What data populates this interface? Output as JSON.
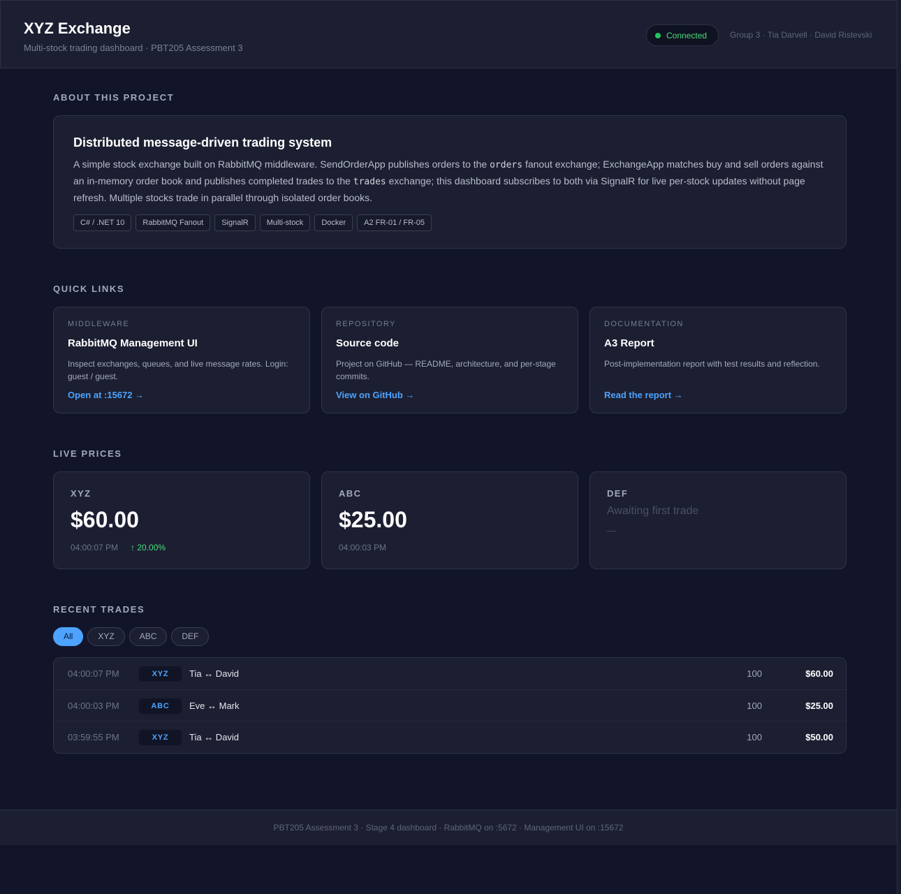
{
  "header": {
    "title": "XYZ Exchange",
    "subtitle": "Multi-stock trading dashboard · PBT205 Assessment 3",
    "status": "Connected",
    "group": "Group 3 · Tia Darvell · David Ristevski"
  },
  "about": {
    "section_label": "ABOUT THIS PROJECT",
    "title": "Distributed message-driven trading system",
    "desc_1": "A simple stock exchange built on RabbitMQ middleware. SendOrderApp publishes orders to the ",
    "code_1": "orders",
    "desc_2": " fanout exchange; ExchangeApp matches buy and sell orders against an in-memory order book and publishes completed trades to the ",
    "code_2": "trades",
    "desc_3": " exchange; this dashboard subscribes to both via SignalR for live per-stock updates without page refresh. Multiple stocks trade in parallel through isolated order books.",
    "tags": [
      "C# / .NET 10",
      "RabbitMQ Fanout",
      "SignalR",
      "Multi-stock",
      "Docker",
      "A2 FR-01 / FR-05"
    ]
  },
  "quick_links": {
    "section_label": "QUICK LINKS",
    "items": [
      {
        "kicker": "MIDDLEWARE",
        "title": "RabbitMQ Management UI",
        "desc": "Inspect exchanges, queues, and live message rates. Login: guest / guest.",
        "link": "Open at :15672 →"
      },
      {
        "kicker": "REPOSITORY",
        "title": "Source code",
        "desc": "Project on GitHub — README, architecture, and per-stage commits.",
        "link": "View on GitHub →"
      },
      {
        "kicker": "DOCUMENTATION",
        "title": "A3 Report",
        "desc": "Post-implementation report with test results and reflection.",
        "link": "Read the report →"
      }
    ]
  },
  "live_prices": {
    "section_label": "LIVE PRICES",
    "items": [
      {
        "symbol": "XYZ",
        "price": "$60.00",
        "time": "04:00:07 PM",
        "change": "↑ 20.00%"
      },
      {
        "symbol": "ABC",
        "price": "$25.00",
        "time": "04:00:03 PM"
      },
      {
        "symbol": "DEF",
        "awaiting": "Awaiting first trade",
        "placeholder": "—"
      }
    ]
  },
  "recent_trades": {
    "section_label": "RECENT TRADES",
    "filters": [
      "All",
      "XYZ",
      "ABC",
      "DEF"
    ],
    "active_filter": "All",
    "rows": [
      {
        "time": "04:00:07 PM",
        "symbol": "XYZ",
        "parties": "Tia ↔ David",
        "qty": "100",
        "price": "$60.00"
      },
      {
        "time": "04:00:03 PM",
        "symbol": "ABC",
        "parties": "Eve ↔ Mark",
        "qty": "100",
        "price": "$25.00"
      },
      {
        "time": "03:59:55 PM",
        "symbol": "XYZ",
        "parties": "Tia ↔ David",
        "qty": "100",
        "price": "$50.00"
      }
    ]
  },
  "footer": {
    "text": "PBT205 Assessment 3 · Stage 4 dashboard · RabbitMQ on :5672 · Management UI on :15672"
  },
  "colors": {
    "accent": "#4da3ff",
    "success": "#22c55e",
    "background": "#12152a",
    "card": "#1c1f31"
  }
}
